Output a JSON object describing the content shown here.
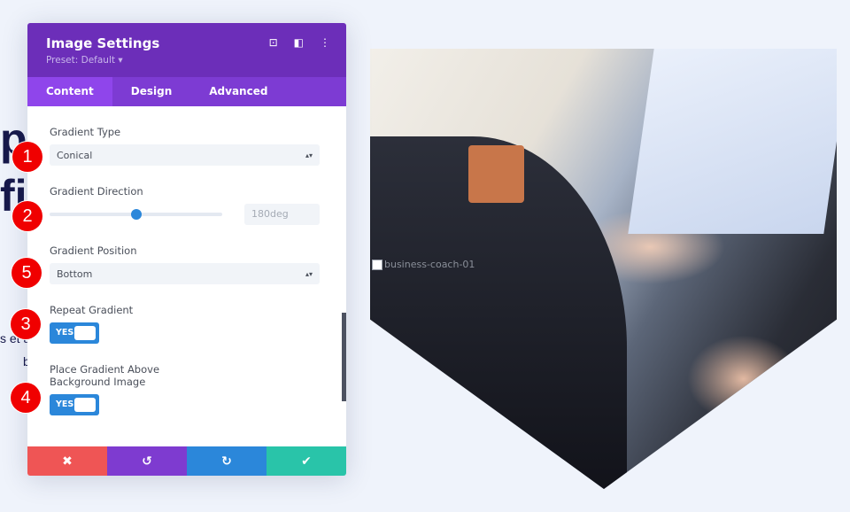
{
  "background": {
    "heading_fragments": [
      "p",
      "fi"
    ],
    "text_fragments": [
      "s et a",
      "b"
    ]
  },
  "image": {
    "alt": "business-coach-01"
  },
  "panel": {
    "title": "Image Settings",
    "preset": "Preset: Default ▾",
    "header_icons": [
      "focus-icon",
      "sidebar-layout-icon",
      "more-vertical-icon"
    ],
    "tabs": [
      {
        "label": "Content",
        "active": true
      },
      {
        "label": "Design"
      },
      {
        "label": "Advanced"
      }
    ],
    "gradient_type": {
      "label": "Gradient Type",
      "value": "Conical"
    },
    "gradient_direction": {
      "label": "Gradient Direction",
      "value": "180deg",
      "slider_percent": 50
    },
    "gradient_position": {
      "label": "Gradient Position",
      "value": "Bottom"
    },
    "repeat_gradient": {
      "label": "Repeat Gradient",
      "value": "YES"
    },
    "place_above": {
      "label_line1": "Place Gradient Above",
      "label_line2": "Background Image",
      "value": "YES"
    },
    "footer": {
      "cancel": "✖",
      "undo": "↺",
      "redo": "↻",
      "save": "✔"
    },
    "footer_colors": {
      "cancel": "#ef5555",
      "undo": "#7e3bd0",
      "redo": "#2b87da",
      "save": "#29c4a9"
    }
  },
  "badges": [
    "1",
    "2",
    "5",
    "3",
    "4"
  ],
  "badge_color": "#f00000"
}
